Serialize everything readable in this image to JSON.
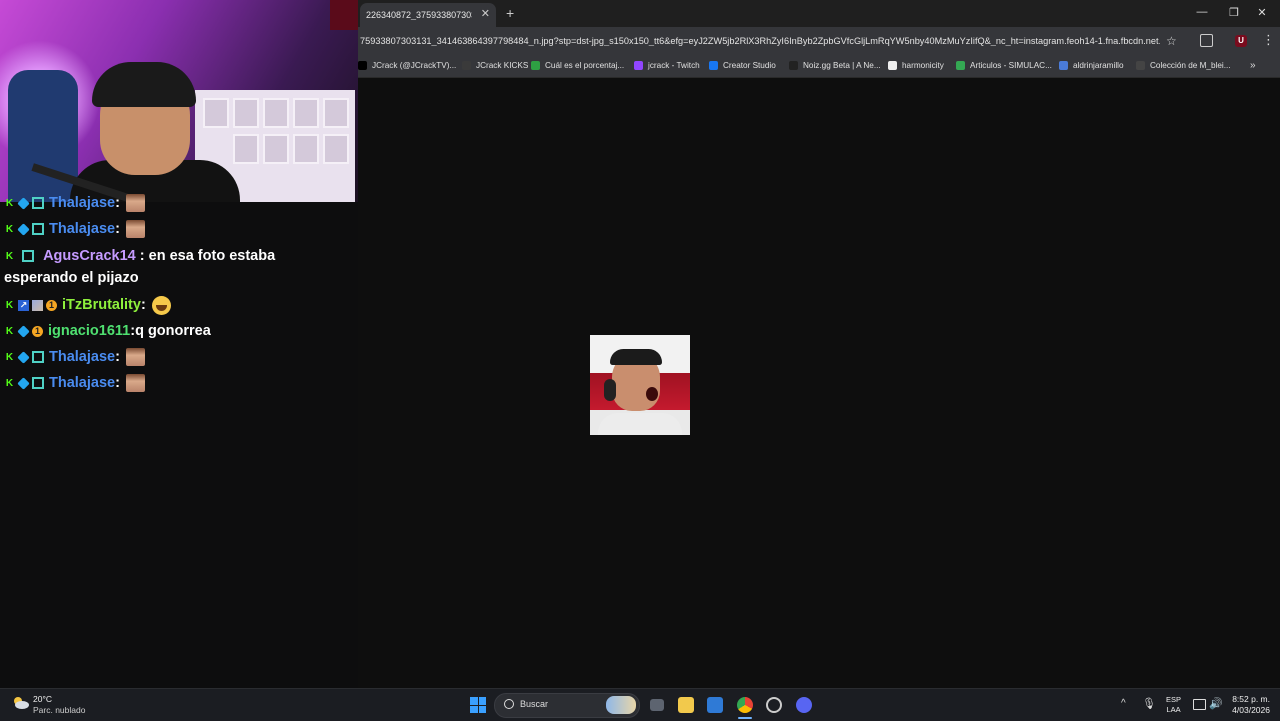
{
  "browser": {
    "tab_title": "226340872_375933807303131...",
    "url": "75933807303131_341463864397798484_n.jpg?stp=dst-jpg_s150x150_tt6&efg=eyJ2ZW5jb2RlX3RhZyI6InByb2ZpbGVfcGljLmRqYW5nby40MzMuYzIifQ&_nc_ht=instagram.feoh14-1.fna.fbcdn.net...",
    "bookmarks": [
      {
        "label": "JCrack (@JCrackTV)...",
        "icon": "x-icon",
        "color": "#000000"
      },
      {
        "label": "JCrack KICKS",
        "icon": "j-icon",
        "color": "#3a3a3a"
      },
      {
        "label": "Cuál es el porcentaj...",
        "icon": "d-icon",
        "color": "#2ea043"
      },
      {
        "label": "jcrack - Twitch",
        "icon": "twitch-icon",
        "color": "#9146ff"
      },
      {
        "label": "Creator Studio",
        "icon": "facebook-icon",
        "color": "#1877f2"
      },
      {
        "label": "Noiz.gg Beta | A Ne...",
        "icon": "noiz-icon",
        "color": "#222222"
      },
      {
        "label": "harmonicity",
        "icon": "harmonicity-icon",
        "color": "#eeeeee"
      },
      {
        "label": "Articulos - SIMULAC...",
        "icon": "drive-icon",
        "color": "#34a853"
      },
      {
        "label": "aldrinjaramillo",
        "icon": "doc-icon",
        "color": "#4a7bd8"
      },
      {
        "label": "Colección de M_blei...",
        "icon": "globe-icon",
        "color": "#444444"
      }
    ]
  },
  "chat": {
    "messages": [
      {
        "user": "Thalajase",
        "sep": " :",
        "text": "",
        "color": "#4a8cf0"
      },
      {
        "user": "Thalajase",
        "sep": " :",
        "text": "",
        "color": "#4a8cf0"
      },
      {
        "user": "AgusCrack14",
        "sep": " :",
        "text": " en esa foto estaba esperando el pijazo",
        "color": "#c59bff"
      },
      {
        "user": "iTzBrutality",
        "sep": " :",
        "text": "",
        "color": "#8ef03c"
      },
      {
        "user": "ignacio1611",
        "sep": " :",
        "text": " q gonorrea",
        "color": "#4fe070"
      },
      {
        "user": "Thalajase",
        "sep": " :",
        "text": "",
        "color": "#4a8cf0"
      },
      {
        "user": "Thalajase",
        "sep": " :",
        "text": "",
        "color": "#4a8cf0"
      }
    ]
  },
  "taskbar": {
    "temperature": "20°C",
    "weather": "Parc. nublado",
    "search_placeholder": "Buscar",
    "lang_line1": "ESP",
    "lang_line2": "LAA",
    "time": "8:52 p. m.",
    "date": "4/03/2026"
  }
}
